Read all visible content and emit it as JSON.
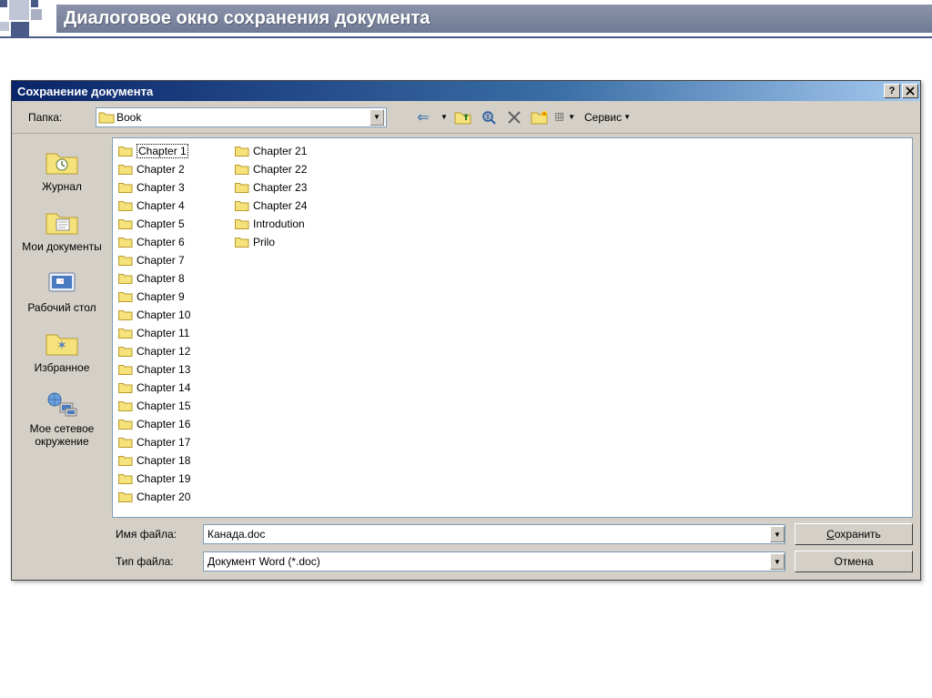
{
  "slide": {
    "title": "Диалоговое окно сохранения документа"
  },
  "dialog": {
    "title": "Сохранение документа"
  },
  "toolbar": {
    "folder_label": "Папка:",
    "current_folder": "Book",
    "tools_label": "Сервис"
  },
  "places": [
    {
      "label": "Журнал",
      "icon": "history"
    },
    {
      "label": "Мои документы",
      "icon": "documents"
    },
    {
      "label": "Рабочий стол",
      "icon": "desktop"
    },
    {
      "label": "Избранное",
      "icon": "favorites"
    },
    {
      "label": "Мое сетевое окружение",
      "icon": "network"
    }
  ],
  "files_col1": [
    "Chapter 1",
    "Chapter 2",
    "Chapter 3",
    "Chapter 4",
    "Chapter 5",
    "Chapter 6",
    "Chapter 7",
    "Chapter 8",
    "Chapter 9",
    "Chapter 10",
    "Chapter 11",
    "Chapter 12",
    "Chapter 13",
    "Chapter 14",
    "Chapter 15"
  ],
  "files_col2": [
    "Chapter 16",
    "Chapter 17",
    "Chapter 18",
    "Chapter 19",
    "Chapter 20",
    "Chapter 21",
    "Chapter 22",
    "Chapter 23",
    "Chapter 24",
    "Introdution",
    "Prilo"
  ],
  "fields": {
    "filename_label": "Имя файла:",
    "filename_value": "Канада.doc",
    "filetype_label": "Тип файла:",
    "filetype_value": "Документ Word (*.doc)"
  },
  "buttons": {
    "save_prefix": "С",
    "save_rest": "охранить",
    "cancel": "Отмена"
  }
}
